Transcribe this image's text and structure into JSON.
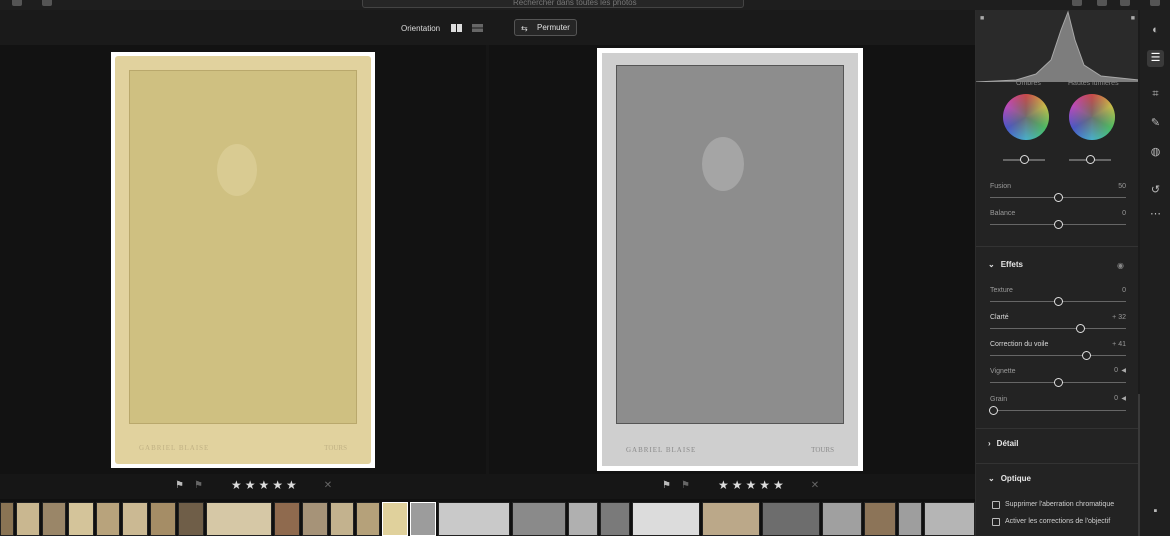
{
  "search": {
    "placeholder": "Rechercher dans toutes les photos"
  },
  "toolbar": {
    "orientation_label": "Orientation",
    "swap_label": "Permuter"
  },
  "ratings": {
    "stars": "★★★★★",
    "reject": "✕",
    "flag": "⚑"
  },
  "photo": {
    "maker_left": "GABRIEL BLAISE",
    "maker_right": "TOURS"
  },
  "panel": {
    "histogram": {
      "shadows": "Ombres",
      "highlights": "Hautes lumières"
    },
    "color_grading": {
      "fusion": {
        "label": "Fusion",
        "value": "50"
      },
      "balance": {
        "label": "Balance",
        "value": "0"
      }
    },
    "effects": {
      "title": "Effets",
      "texture": {
        "label": "Texture",
        "value": "0"
      },
      "clarity": {
        "label": "Clarté",
        "value": "+ 32"
      },
      "dehaze": {
        "label": "Correction du voile",
        "value": "+ 41"
      },
      "vignette": {
        "label": "Vignette",
        "value": "0"
      },
      "grain": {
        "label": "Grain",
        "value": "0"
      }
    },
    "detail": {
      "title": "Détail"
    },
    "optics": {
      "title": "Optique",
      "remove_ca": "Supprimer l'aberration chromatique",
      "lens_corrections": "Activer les corrections de l'objectif"
    }
  },
  "icons": [
    "edit-icon",
    "crop-icon",
    "healing-icon",
    "masking-icon",
    "history-icon",
    "more-icon",
    "comment-icon",
    "presets-icon"
  ]
}
